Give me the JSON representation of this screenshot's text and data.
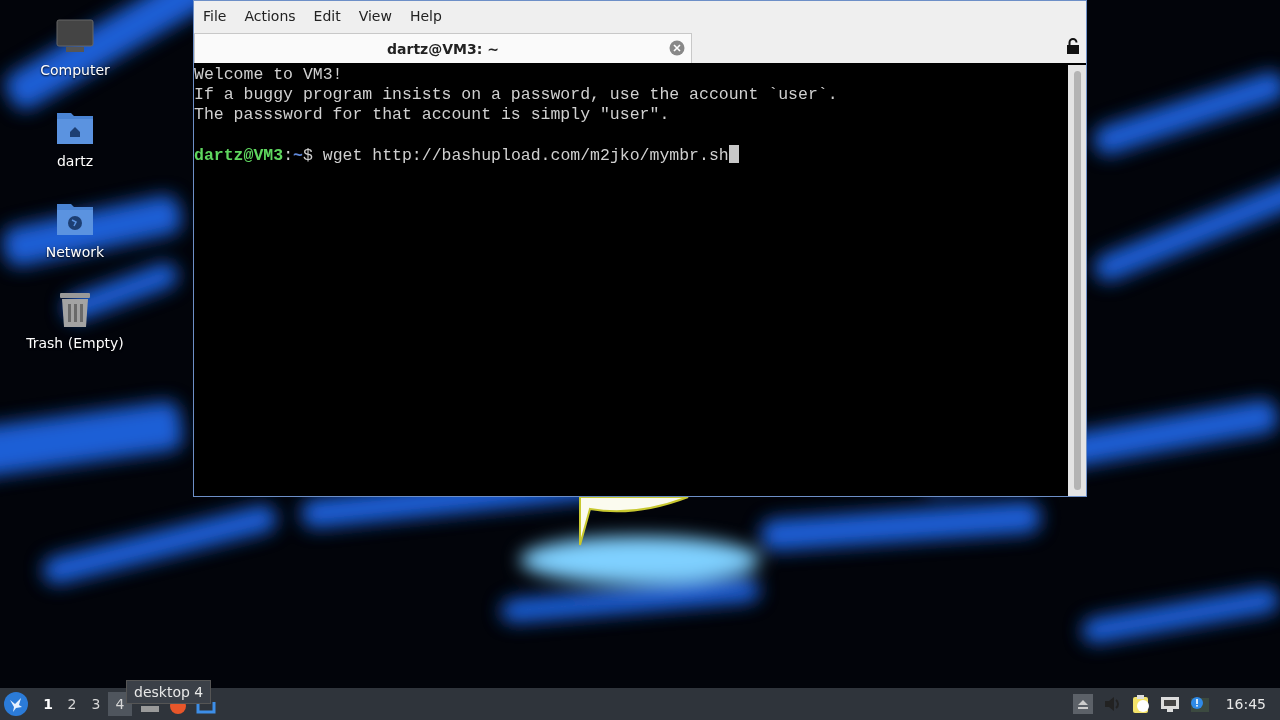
{
  "desktop_icons": [
    {
      "kind": "computer",
      "label": "Computer"
    },
    {
      "kind": "home",
      "label": "dartz"
    },
    {
      "kind": "network",
      "label": "Network"
    },
    {
      "kind": "trash",
      "label": "Trash (Empty)"
    }
  ],
  "terminal": {
    "menu": [
      "File",
      "Actions",
      "Edit",
      "View",
      "Help"
    ],
    "tabs": [
      {
        "title": "dartz@VM3: ~",
        "selected": true
      }
    ],
    "lines": [
      "Welcome to VM3!",
      "If a buggy program insists on a password, use the account `user`.",
      "The passsword for that account is simply \"user\"."
    ],
    "prompt": {
      "user": "dartz@VM3",
      "separator": ":",
      "path": "~",
      "symbol": "$",
      "command": "wget http://bashupload.com/m2jko/mymbr.sh"
    }
  },
  "taskbar": {
    "workspaces": [
      {
        "label": "1",
        "selected": true,
        "hovered": false
      },
      {
        "label": "2",
        "selected": false,
        "hovered": false
      },
      {
        "label": "3",
        "selected": false,
        "hovered": false
      },
      {
        "label": "4",
        "selected": false,
        "hovered": true
      }
    ],
    "tooltip": "desktop 4",
    "clock": "16:45"
  }
}
